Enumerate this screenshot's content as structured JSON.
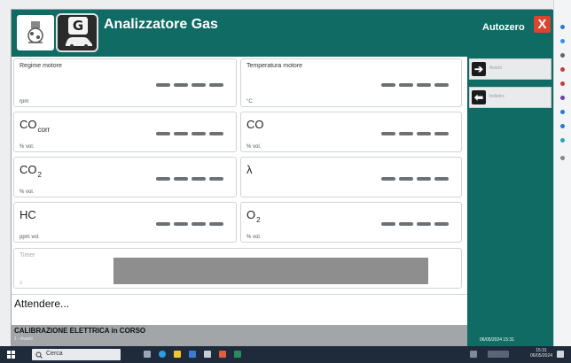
{
  "header": {
    "title": "Analizzatore Gas",
    "g_badge": "G",
    "autozero_label": "Autozero",
    "close_label": "X"
  },
  "panels": {
    "regime": {
      "label": "Regime motore",
      "unit": "rpm",
      "value": "- - - -"
    },
    "temperatura": {
      "label": "Temperatura motore",
      "unit": "°C",
      "value": "- - - -"
    },
    "co_corr": {
      "symbol": "CO",
      "sub": "corr",
      "unit": "% vol.",
      "value": "- - - -"
    },
    "co": {
      "symbol": "CO",
      "unit": "% vol.",
      "value": "- - - -"
    },
    "co2": {
      "symbol": "CO",
      "sub": "2",
      "unit": "% vol.",
      "value": "- - - -"
    },
    "lambda": {
      "symbol": "λ",
      "unit": "",
      "value": "- - - -"
    },
    "hc": {
      "symbol": "HC",
      "unit": "ppm vol.",
      "value": "- - - -"
    },
    "o2": {
      "symbol": "O",
      "sub": "2",
      "unit": "% vol.",
      "value": "- - - -"
    },
    "timer": {
      "label": "Timer",
      "unit": "s"
    }
  },
  "sidebar": {
    "next_label": "Avanti",
    "back_label": "Indietro",
    "datetime": "06/05/2024 15:31"
  },
  "message": "Attendere...",
  "status": {
    "line1": "CALIBRAZIONE ELETTRICA in CORSO",
    "line2": "1 - Avanti"
  },
  "taskbar": {
    "search_placeholder": "Cerca",
    "time": "15:31",
    "date": "06/05/2024"
  },
  "colors": {
    "accent": "#0f6b63",
    "close": "#d9452e",
    "status_bar": "#a2a6a8",
    "timer_bar": "#8e8e8e"
  }
}
